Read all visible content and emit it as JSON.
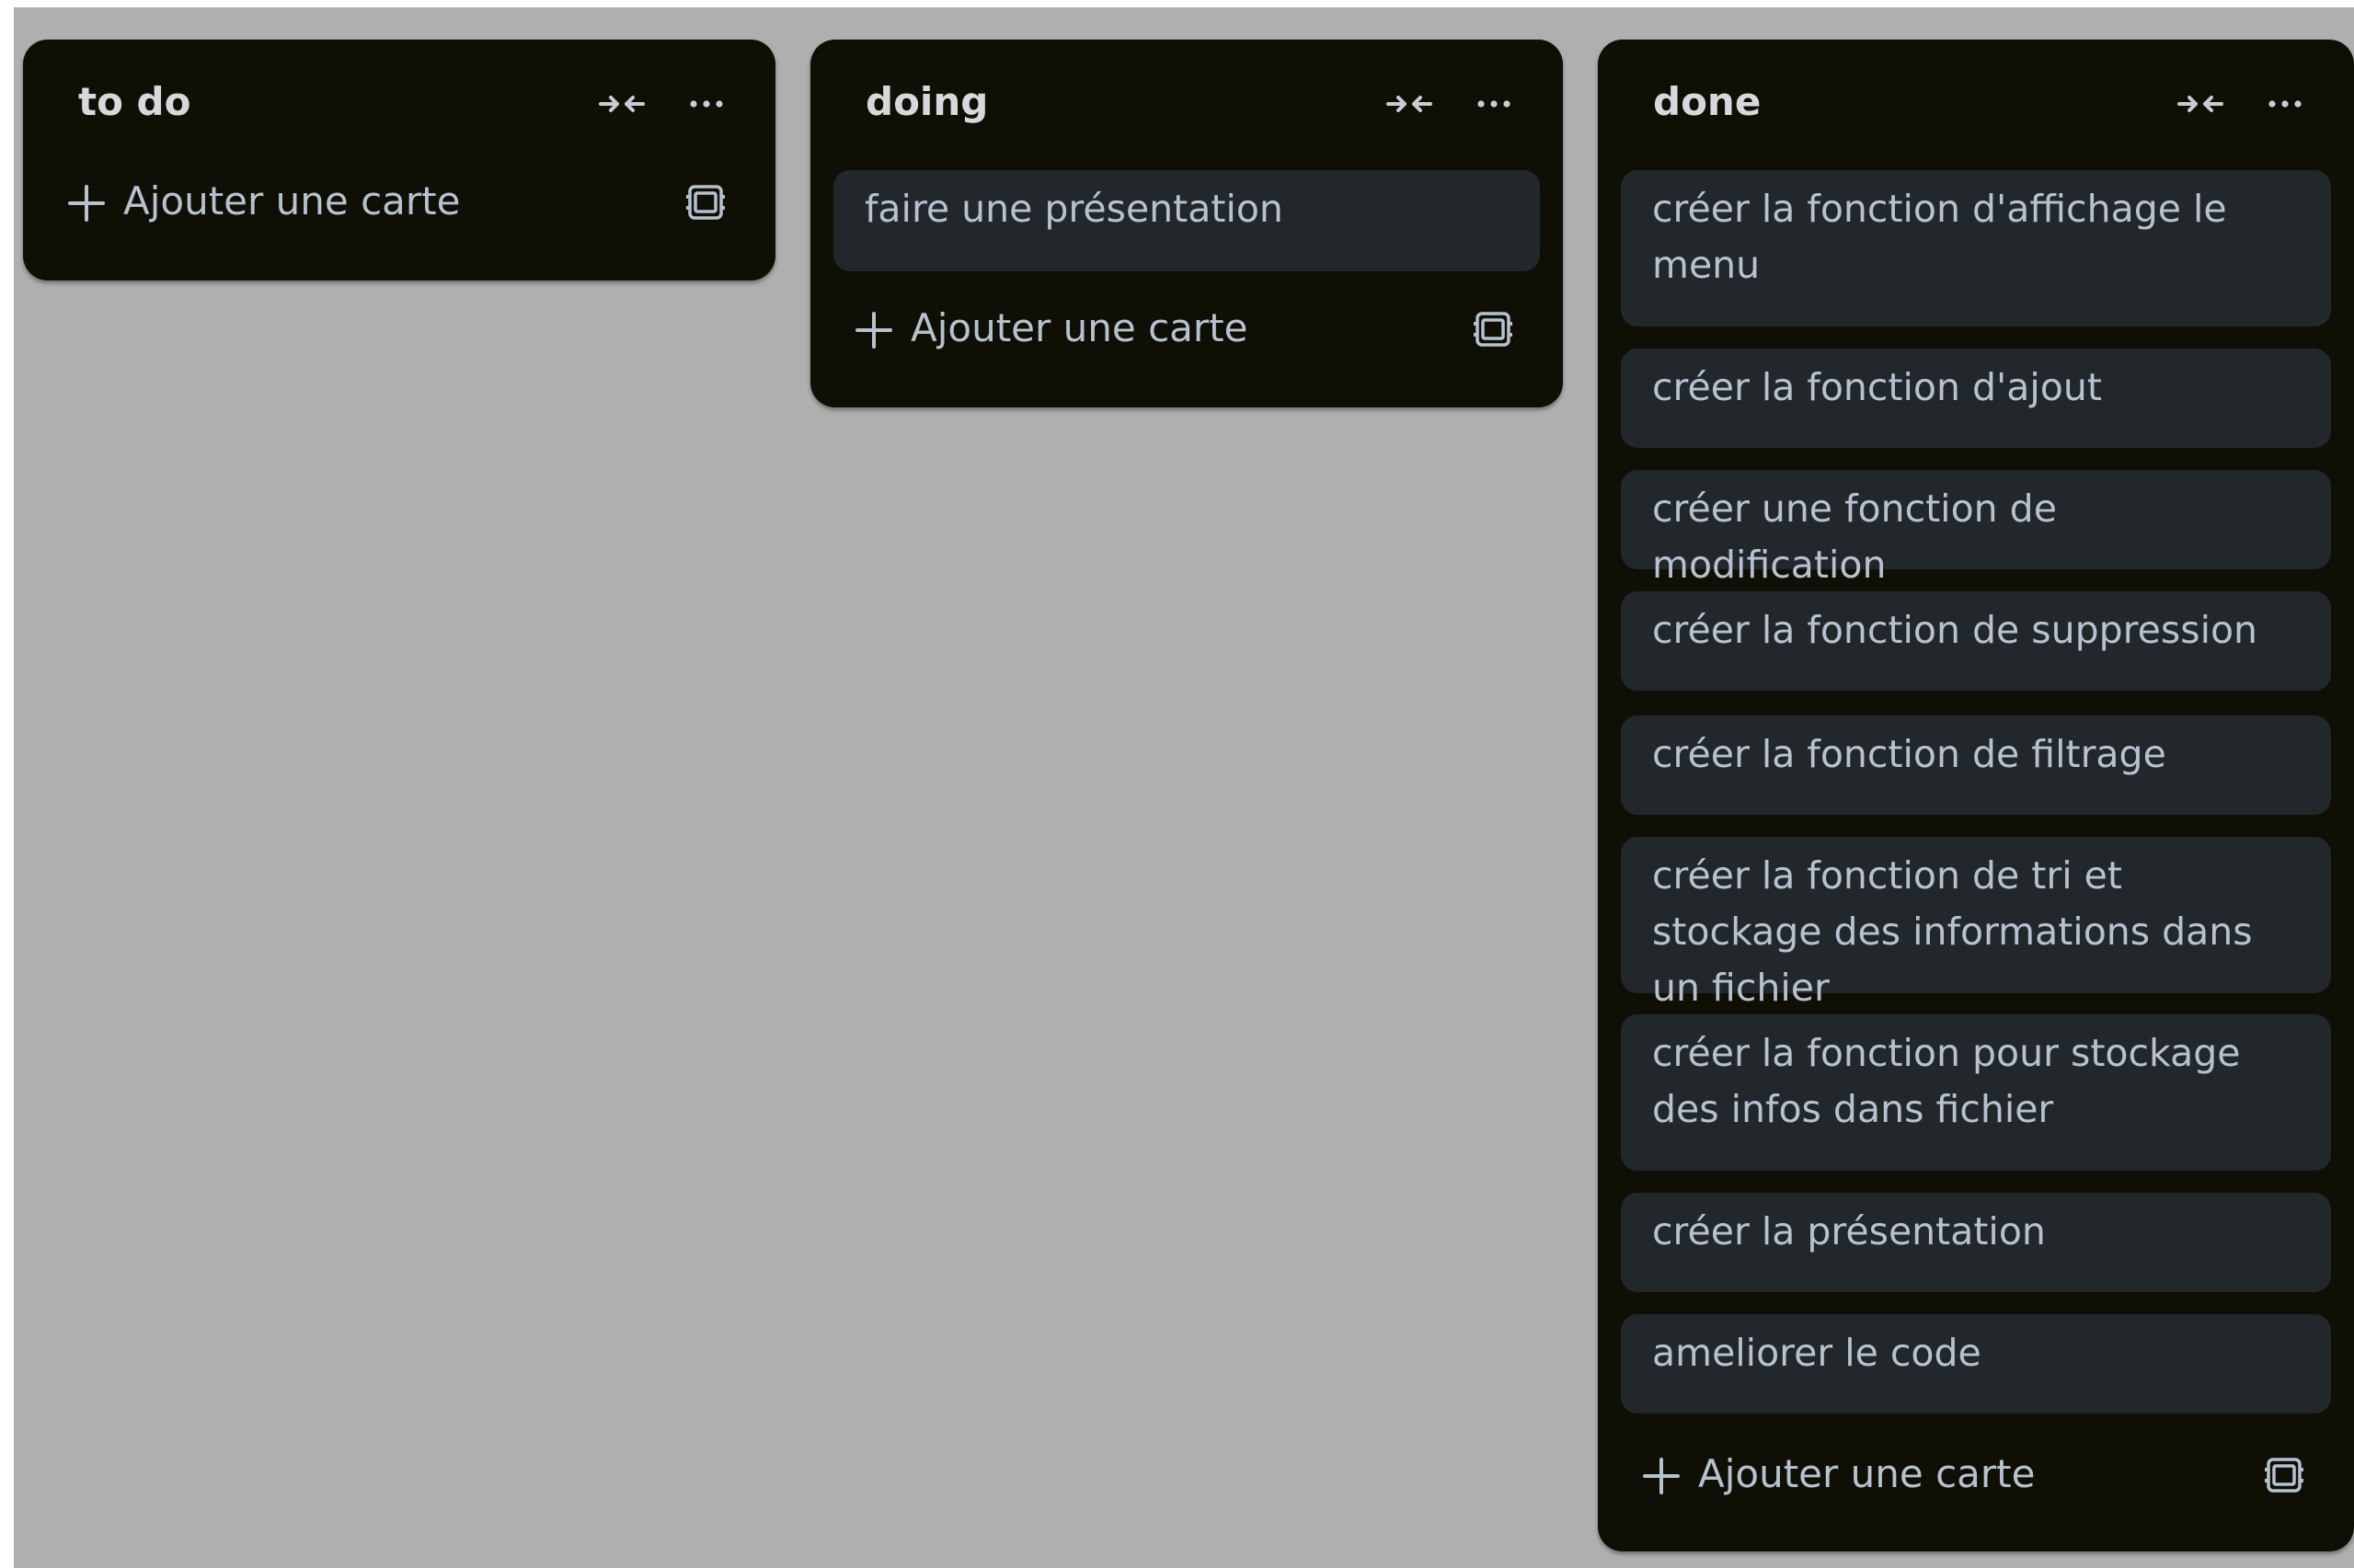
{
  "colors": {
    "board_background": "#afafaf",
    "column_background": "#0f0f06",
    "card_background": "#22272b",
    "text": "#b6c2cf",
    "title_text": "#d6d9dc"
  },
  "icons": {
    "collapse": "collapse-arrows-icon",
    "more": "more-dots-icon",
    "add": "plus-icon",
    "template": "card-template-icon"
  },
  "columns": [
    {
      "title": "to do",
      "cards": [],
      "add_label": "Ajouter une carte"
    },
    {
      "title": "doing",
      "cards": [
        "faire une présentation"
      ],
      "add_label": "Ajouter une carte"
    },
    {
      "title": "done",
      "cards": [
        "créer la fonction d'affichage le menu",
        "créer la fonction d'ajout",
        "créer une fonction de modification",
        "créer la fonction de suppression",
        "créer la fonction de filtrage",
        "créer la fonction de tri et stockage des informations dans un fichier",
        "créer la fonction pour stockage des infos dans fichier",
        "créer la présentation",
        "ameliorer le code"
      ],
      "add_label": "Ajouter une carte"
    }
  ]
}
